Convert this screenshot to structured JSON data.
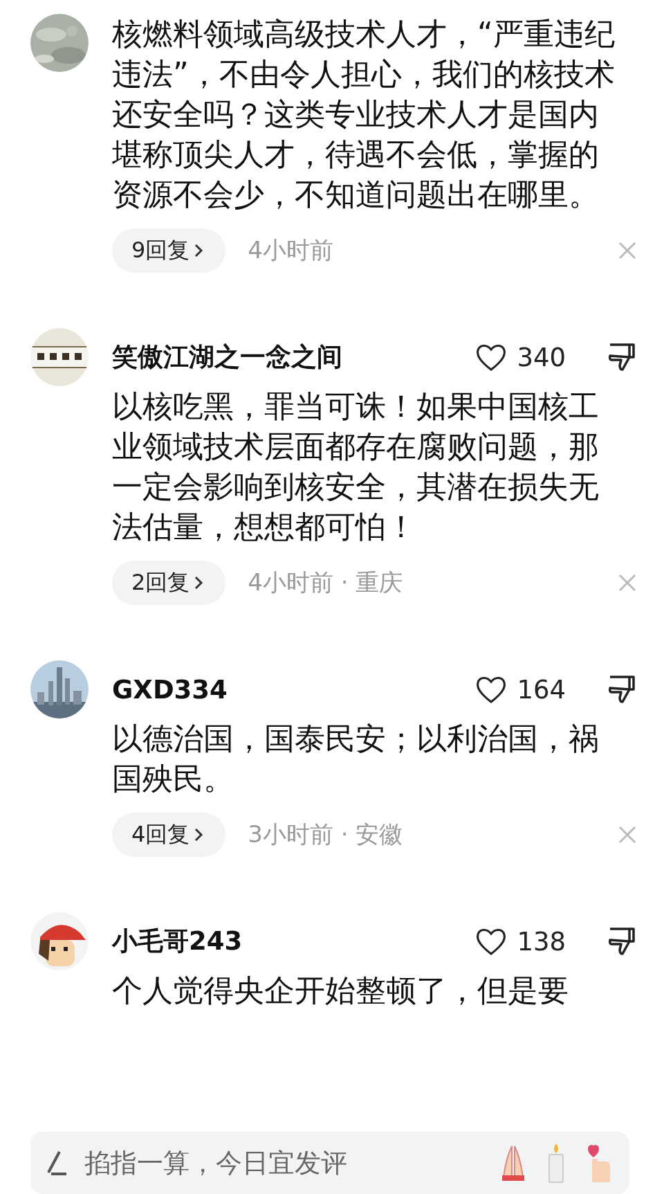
{
  "comments": [
    {
      "body": "核燃料领域高级技术人才，“严重违纪违法”，不由令人担心，我们的核技术还安全吗？这类专业技术人才是国内堪称顶尖人才，待遇不会低，掌握的资源不会少，不知道问题出在哪里。",
      "replies": "9回复",
      "meta": "4小时前"
    },
    {
      "name": "笑傲江湖之一念之间",
      "likes": "340",
      "body": "以核吃黑，罪当可诛！如果中国核工业领域技术层面都存在腐败问题，那一定会影响到核安全，其潜在损失无法估量，想想都可怕！",
      "replies": "2回复",
      "meta": "4小时前 · 重庆"
    },
    {
      "name": "GXD334",
      "likes": "164",
      "body": "以德治国，国泰民安；以利治国，祸国殃民。",
      "replies": "4回复",
      "meta": "3小时前 · 安徽"
    },
    {
      "name": "小毛哥243",
      "likes": "138",
      "body": "个人觉得央企开始整顿了，但是要"
    }
  ],
  "composer": {
    "placeholder": "掐指一算，今日宜发评"
  }
}
